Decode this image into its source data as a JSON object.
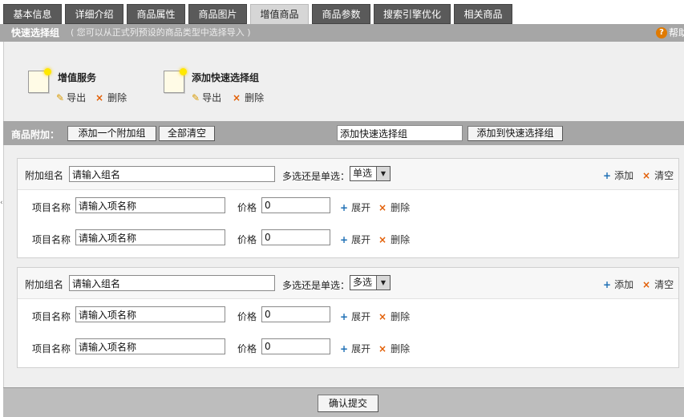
{
  "tabs": [
    {
      "label": "基本信息",
      "active": false
    },
    {
      "label": "详细介绍",
      "active": false
    },
    {
      "label": "商品属性",
      "active": false
    },
    {
      "label": "商品图片",
      "active": false
    },
    {
      "label": "增值商品",
      "active": true
    },
    {
      "label": "商品参数",
      "active": false
    },
    {
      "label": "搜索引擎优化",
      "active": false
    },
    {
      "label": "相关商品",
      "active": false
    }
  ],
  "title_bar": {
    "title": "快速选择组",
    "hint": "( 您可以从正式列预设的商品类型中选择导入 )",
    "help_icon": "?",
    "help_label": "帮助"
  },
  "quick_groups": [
    {
      "name": "增值服务",
      "export_label": "导出",
      "delete_label": "删除"
    },
    {
      "name": "添加快速选择组",
      "export_label": "导出",
      "delete_label": "删除"
    }
  ],
  "addon_bar": {
    "label": "商品附加：",
    "add_group_button": "添加一个附加组",
    "clear_all_button": "全部清空",
    "quick_group_input_value": "添加快速选择组",
    "add_to_quick_button": "添加到快速选择组"
  },
  "addon_groups": [
    {
      "group_name_label": "附加组名",
      "group_name_value": "请输入组名",
      "mode_label": "多选还是单选：",
      "mode_value": "单选",
      "add_label": "添加",
      "clear_label": "清空",
      "items": [
        {
          "name_label": "项目名称",
          "name_value": "请输入项名称",
          "price_label": "价格",
          "price_value": "0",
          "expand_label": "展开",
          "delete_label": "删除"
        },
        {
          "name_label": "项目名称",
          "name_value": "请输入项名称",
          "price_label": "价格",
          "price_value": "0",
          "expand_label": "展开",
          "delete_label": "删除"
        }
      ]
    },
    {
      "group_name_label": "附加组名",
      "group_name_value": "请输入组名",
      "mode_label": "多选还是单选：",
      "mode_value": "多选",
      "add_label": "添加",
      "clear_label": "清空",
      "items": [
        {
          "name_label": "项目名称",
          "name_value": "请输入项名称",
          "price_label": "价格",
          "price_value": "0",
          "expand_label": "展开",
          "delete_label": "删除"
        },
        {
          "name_label": "项目名称",
          "name_value": "请输入项名称",
          "price_label": "价格",
          "price_value": "0",
          "expand_label": "展开",
          "delete_label": "删除"
        }
      ]
    }
  ],
  "footer": {
    "submit_button": "确认提交"
  },
  "icons": {
    "pencil": "pencil-icon",
    "delete": "x-icon",
    "add": "plus-icon",
    "note": "note-icon",
    "help": "help-icon"
  },
  "colors": {
    "tab_bg": "#5a5a5a",
    "tab_active_bg": "#d6d6d6",
    "bar_bg": "#a6a6a6",
    "plus": "#1e6fb5",
    "x": "#e25c00",
    "help": "#e07a00"
  }
}
